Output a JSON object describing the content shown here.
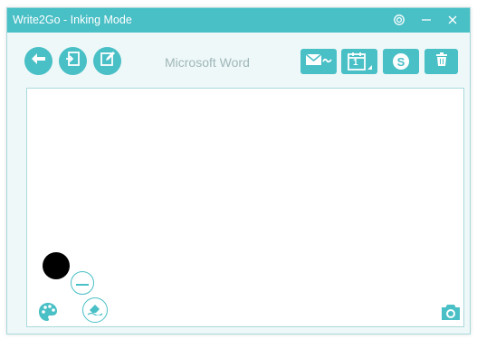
{
  "window": {
    "title": "Write2Go - Inking Mode",
    "accent_color": "#49bfc6",
    "background_color": "#eff8f8"
  },
  "titlebar": {
    "icons": [
      "settings-icon",
      "minimize-icon",
      "close-icon"
    ]
  },
  "toolbar": {
    "app_label": "Microsoft Word",
    "left_buttons": [
      "back-icon",
      "insert-icon",
      "edit-icon"
    ],
    "right_buttons": [
      "email-icon",
      "calendar-icon",
      "skype-icon",
      "trash-icon"
    ],
    "calendar_day": "1",
    "skype_letter": "S"
  },
  "canvas": {
    "ink_color": "#000000",
    "tools": [
      "ink-color-swatch",
      "pen-size-minus-icon",
      "color-palette-icon",
      "eraser-icon",
      "camera-icon"
    ]
  }
}
